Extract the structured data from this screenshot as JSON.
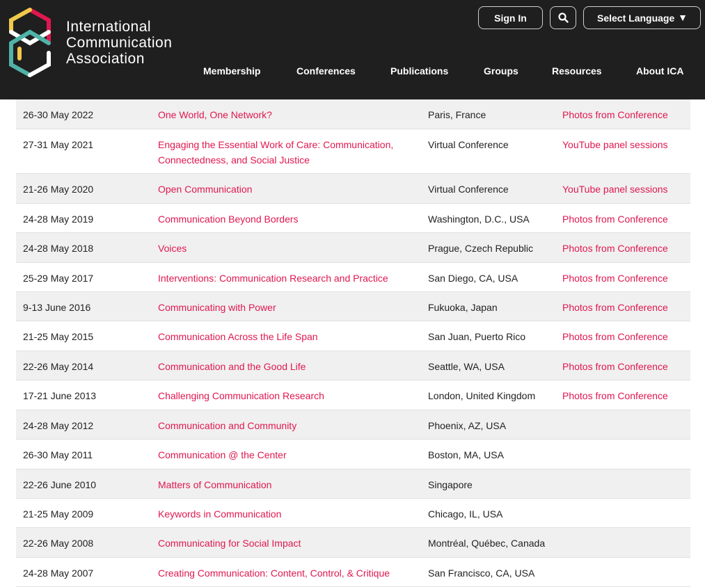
{
  "header": {
    "logo_lines": [
      "International",
      "Communication",
      "Association"
    ],
    "sign_in_label": "Sign In",
    "language_label": "Select Language",
    "nav": [
      "Membership",
      "Conferences",
      "Publications",
      "Groups",
      "Resources",
      "About ICA"
    ]
  },
  "conferences": [
    {
      "date": "26-30 May 2022",
      "theme": "One World, One Network?",
      "location": "Paris, France",
      "media": "Photos from Conference"
    },
    {
      "date": "27-31 May 2021",
      "theme": "Engaging the Essential Work of Care: Communication, Connectedness, and Social Justice",
      "location": "Virtual Conference",
      "media": "YouTube panel sessions"
    },
    {
      "date": "21-26 May 2020",
      "theme": "Open Communication",
      "location": "Virtual Conference",
      "media": "YouTube panel sessions"
    },
    {
      "date": "24-28 May 2019",
      "theme": "Communication Beyond Borders",
      "location": "Washington, D.C., USA",
      "media": "Photos from Conference"
    },
    {
      "date": "24-28 May 2018",
      "theme": "Voices",
      "location": "Prague, Czech Republic",
      "media": "Photos from Conference"
    },
    {
      "date": "25-29 May 2017",
      "theme": "Interventions: Communication Research and Practice",
      "location": "San Diego, CA, USA",
      "media": "Photos from Conference"
    },
    {
      "date": "9-13 June 2016",
      "theme": "Communicating with Power",
      "location": "Fukuoka, Japan",
      "media": "Photos from Conference"
    },
    {
      "date": "21-25 May 2015",
      "theme": "Communication Across the Life Span",
      "location": "San Juan, Puerto Rico",
      "media": "Photos from Conference"
    },
    {
      "date": "22-26 May 2014",
      "theme": "Communication and the Good Life",
      "location": "Seattle, WA, USA",
      "media": "Photos from Conference"
    },
    {
      "date": "17-21 June 2013",
      "theme": "Challenging Communication Research",
      "location": "London, United Kingdom",
      "media": "Photos from Conference"
    },
    {
      "date": "24-28 May 2012",
      "theme": "Communication and Community",
      "location": "Phoenix, AZ, USA",
      "media": ""
    },
    {
      "date": "26-30 May 2011",
      "theme": "Communication @ the Center",
      "location": "Boston, MA, USA",
      "media": ""
    },
    {
      "date": "22-26 June 2010",
      "theme": "Matters of Communication",
      "location": "Singapore",
      "media": ""
    },
    {
      "date": "21-25 May 2009",
      "theme": "Keywords in Communication",
      "location": "Chicago, IL, USA",
      "media": ""
    },
    {
      "date": "22-26 May 2008",
      "theme": "Communicating for Social Impact",
      "location": "Montréal, Québec, Canada",
      "media": ""
    },
    {
      "date": "24-28 May 2007",
      "theme": "Creating Communication: Content, Control, & Critique",
      "location": "San Francisco, CA, USA",
      "media": ""
    }
  ],
  "colors": {
    "header_bg": "#1f1f1f",
    "link": "#e0174f",
    "logo_red": "#e0174f",
    "logo_yellow": "#f2c94c",
    "logo_teal": "#4fb3a9",
    "logo_white": "#ffffff"
  },
  "icons": {
    "search": "search-icon",
    "language_dropdown": "caret-down-icon"
  }
}
